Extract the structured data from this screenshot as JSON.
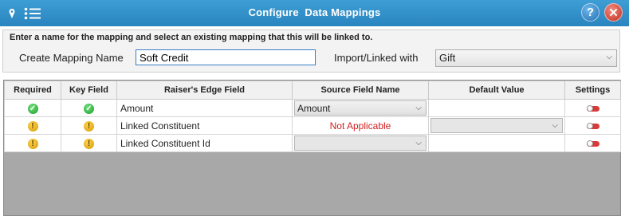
{
  "window": {
    "title": "Configure  Data Mappings",
    "help_label": "?",
    "close_label": "✕"
  },
  "top_panel": {
    "instructions": "Enter a name for the mapping and select an existing mapping that this will be linked to.",
    "name_label": "Create Mapping Name",
    "name_value": "Soft Credit",
    "import_label": "Import/Linked with",
    "import_value": "Gift"
  },
  "grid": {
    "columns": [
      "Required",
      "Key Field",
      "Raiser's Edge Field",
      "Source Field Name",
      "Default Value",
      "Settings"
    ],
    "rows": [
      {
        "required": "ok",
        "key": "ok",
        "field": "Amount",
        "source": "Amount",
        "source_type": "select",
        "default": "",
        "default_type": "text"
      },
      {
        "required": "warn",
        "key": "warn",
        "field": "Linked Constituent",
        "source": "Not Applicable",
        "source_type": "text-red",
        "default": "",
        "default_type": "select-disabled"
      },
      {
        "required": "warn",
        "key": "warn",
        "field": "Linked Constituent Id",
        "source": "",
        "source_type": "select-disabled",
        "default": "",
        "default_type": "text"
      }
    ]
  },
  "colors": {
    "titlebar": "#2a84bf",
    "ok": "#1d9c2b",
    "warn": "#d49a07",
    "not_applicable": "#d12020",
    "toggle": "#d83a3a"
  },
  "icons": [
    "pin-icon",
    "list-menu-icon",
    "help-icon",
    "close-icon",
    "check-icon",
    "warning-icon",
    "toggle-icon",
    "chevron-down-icon"
  ]
}
